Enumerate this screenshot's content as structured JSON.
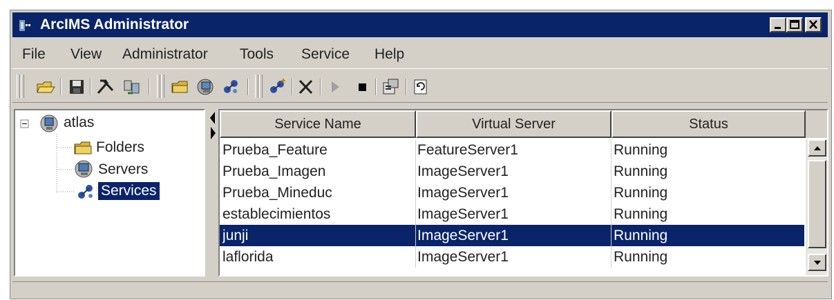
{
  "window": {
    "title": "ArcIMS Administrator"
  },
  "menu": [
    "File",
    "View",
    "Administrator",
    "Tools",
    "Service",
    "Help"
  ],
  "toolbar": {
    "buttons": [
      "open-folder-icon",
      "save-icon",
      "tools-icon",
      "refresh-icon",
      "folder-icon",
      "server-icon",
      "services-icon",
      "add-service-icon",
      "delete-icon",
      "play-icon",
      "stop-icon",
      "properties-icon",
      "refresh-service-icon"
    ]
  },
  "tree": {
    "root": "atlas",
    "children": [
      "Folders",
      "Servers",
      "Services"
    ],
    "selected": "Services"
  },
  "table": {
    "columns": [
      "Service Name",
      "Virtual Server",
      "Status"
    ],
    "rows": [
      [
        "Prueba_Feature",
        "FeatureServer1",
        "Running"
      ],
      [
        "Prueba_Imagen",
        "ImageServer1",
        "Running"
      ],
      [
        "Prueba_Mineduc",
        "ImageServer1",
        "Running"
      ],
      [
        "establecimientos",
        "ImageServer1",
        "Running"
      ],
      [
        "junji",
        "ImageServer1",
        "Running"
      ],
      [
        "laflorida",
        "ImageServer1",
        "Running"
      ]
    ],
    "selected_row": "junji"
  },
  "colors": {
    "titlebar": "#0a246a",
    "selection": "#0a246a",
    "chrome": "#d4d0c8"
  }
}
